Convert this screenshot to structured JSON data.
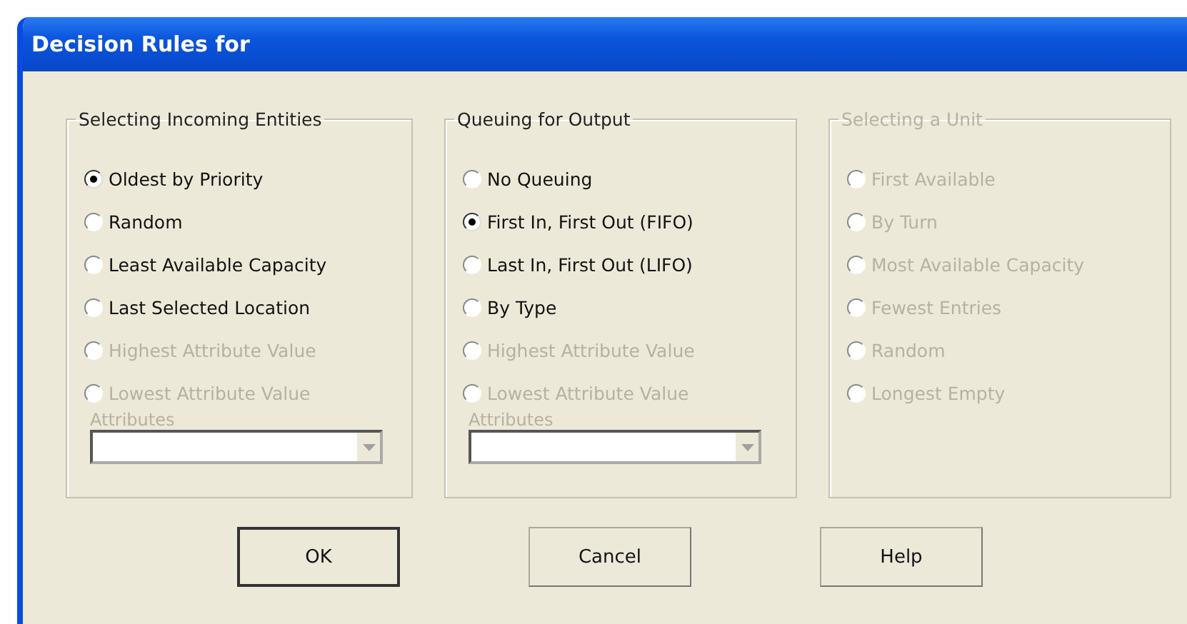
{
  "window": {
    "title": "Decision Rules for"
  },
  "groups": [
    {
      "title": "Selecting Incoming Entities",
      "disabled": false,
      "options": [
        {
          "label": "Oldest by Priority",
          "selected": true,
          "disabled": false
        },
        {
          "label": "Random",
          "selected": false,
          "disabled": false
        },
        {
          "label": "Least Available Capacity",
          "selected": false,
          "disabled": false
        },
        {
          "label": "Last Selected Location",
          "selected": false,
          "disabled": false
        },
        {
          "label": "Highest Attribute Value",
          "selected": false,
          "disabled": true
        },
        {
          "label": "Lowest Attribute Value",
          "selected": false,
          "disabled": true
        }
      ],
      "attributes": {
        "label": "Attributes",
        "disabled": true
      }
    },
    {
      "title": "Queuing for Output",
      "disabled": false,
      "options": [
        {
          "label": "No Queuing",
          "selected": false,
          "disabled": false
        },
        {
          "label": "First In, First Out (FIFO)",
          "selected": true,
          "disabled": false
        },
        {
          "label": "Last In, First Out (LIFO)",
          "selected": false,
          "disabled": false
        },
        {
          "label": "By Type",
          "selected": false,
          "disabled": false
        },
        {
          "label": "Highest Attribute Value",
          "selected": false,
          "disabled": true
        },
        {
          "label": "Lowest Attribute Value",
          "selected": false,
          "disabled": true
        }
      ],
      "attributes": {
        "label": "Attributes",
        "disabled": true
      }
    },
    {
      "title": "Selecting a Unit",
      "disabled": true,
      "options": [
        {
          "label": "First Available",
          "selected": false,
          "disabled": true
        },
        {
          "label": "By Turn",
          "selected": false,
          "disabled": true
        },
        {
          "label": "Most Available Capacity",
          "selected": false,
          "disabled": true
        },
        {
          "label": "Fewest Entries",
          "selected": false,
          "disabled": true
        },
        {
          "label": "Random",
          "selected": false,
          "disabled": true
        },
        {
          "label": "Longest Empty",
          "selected": false,
          "disabled": true
        }
      ]
    }
  ],
  "buttons": [
    {
      "label": "OK",
      "default": true
    },
    {
      "label": "Cancel",
      "default": false
    },
    {
      "label": "Help",
      "default": false
    }
  ]
}
